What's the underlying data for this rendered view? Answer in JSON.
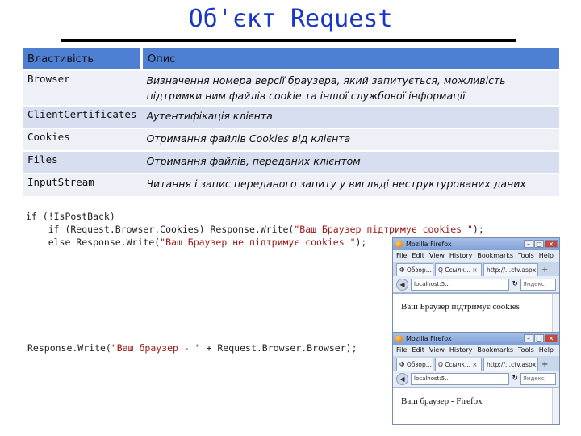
{
  "slide": {
    "title": "Об'єкт Request"
  },
  "table": {
    "headers": [
      "Властивість",
      "Опис"
    ],
    "rows": [
      {
        "property": "Browser",
        "description": "Визначення номера версії браузера, який запитується, можливість підтримки ним файлів cookie та іншої службової інформації"
      },
      {
        "property": "ClientCertificates",
        "description": "Аутентифікація клієнта"
      },
      {
        "property": "Cookies",
        "description": "Отримання файлів Cookies від клієнта"
      },
      {
        "property": "Files",
        "description": "Отримання файлів, переданих клієнтом"
      },
      {
        "property": "InputStream",
        "description": "Читання і запис переданого запиту у вигляді неструктурованих даних"
      }
    ]
  },
  "code1": {
    "line1": "if (!IsPostBack)",
    "line2_pre": "    if (Request.Browser.Cookies) Response.Write(",
    "line2_str": "\"Ваш Браузер підтримує cookies \"",
    "line2_post": ");",
    "line3_pre": "    else Response.Write(",
    "line3_str": "\"Ваш Браузер не підтримує cookies \"",
    "line3_post": ");"
  },
  "code2": {
    "pre": "Response.Write(",
    "str": "\"Ваш браузер - \"",
    "post": " + Request.Browser.Browser);"
  },
  "browser1": {
    "window_title": "Mozilla Firefox",
    "menu": [
      "File",
      "Edit",
      "View",
      "History",
      "Bookmarks",
      "Tools",
      "Help"
    ],
    "tabs": [
      "Ф Обзор...",
      "Q Ссылк...",
      "http://...ctv.aspx"
    ],
    "url": "localhost:5...",
    "search_placeholder": "Яндекс",
    "message": "Ваш Браузер підтримує cookies"
  },
  "browser2": {
    "window_title": "Mozilla Firefox",
    "menu": [
      "File",
      "Edit",
      "View",
      "History",
      "Bookmarks",
      "Tools",
      "Help"
    ],
    "tabs": [
      "Ф Обзор...",
      "Q Ссылк...",
      "http://...ctv.aspx"
    ],
    "url": "localhost:5...",
    "search_placeholder": "Яндекс",
    "message": "Ваш браузер - Firefox"
  },
  "colors": {
    "title": "#1a36c8",
    "header_bg": "#4e7fd2",
    "row_bg_a": "#d6def0",
    "row_bg_b": "#edf0f7",
    "string": "#a31515"
  }
}
